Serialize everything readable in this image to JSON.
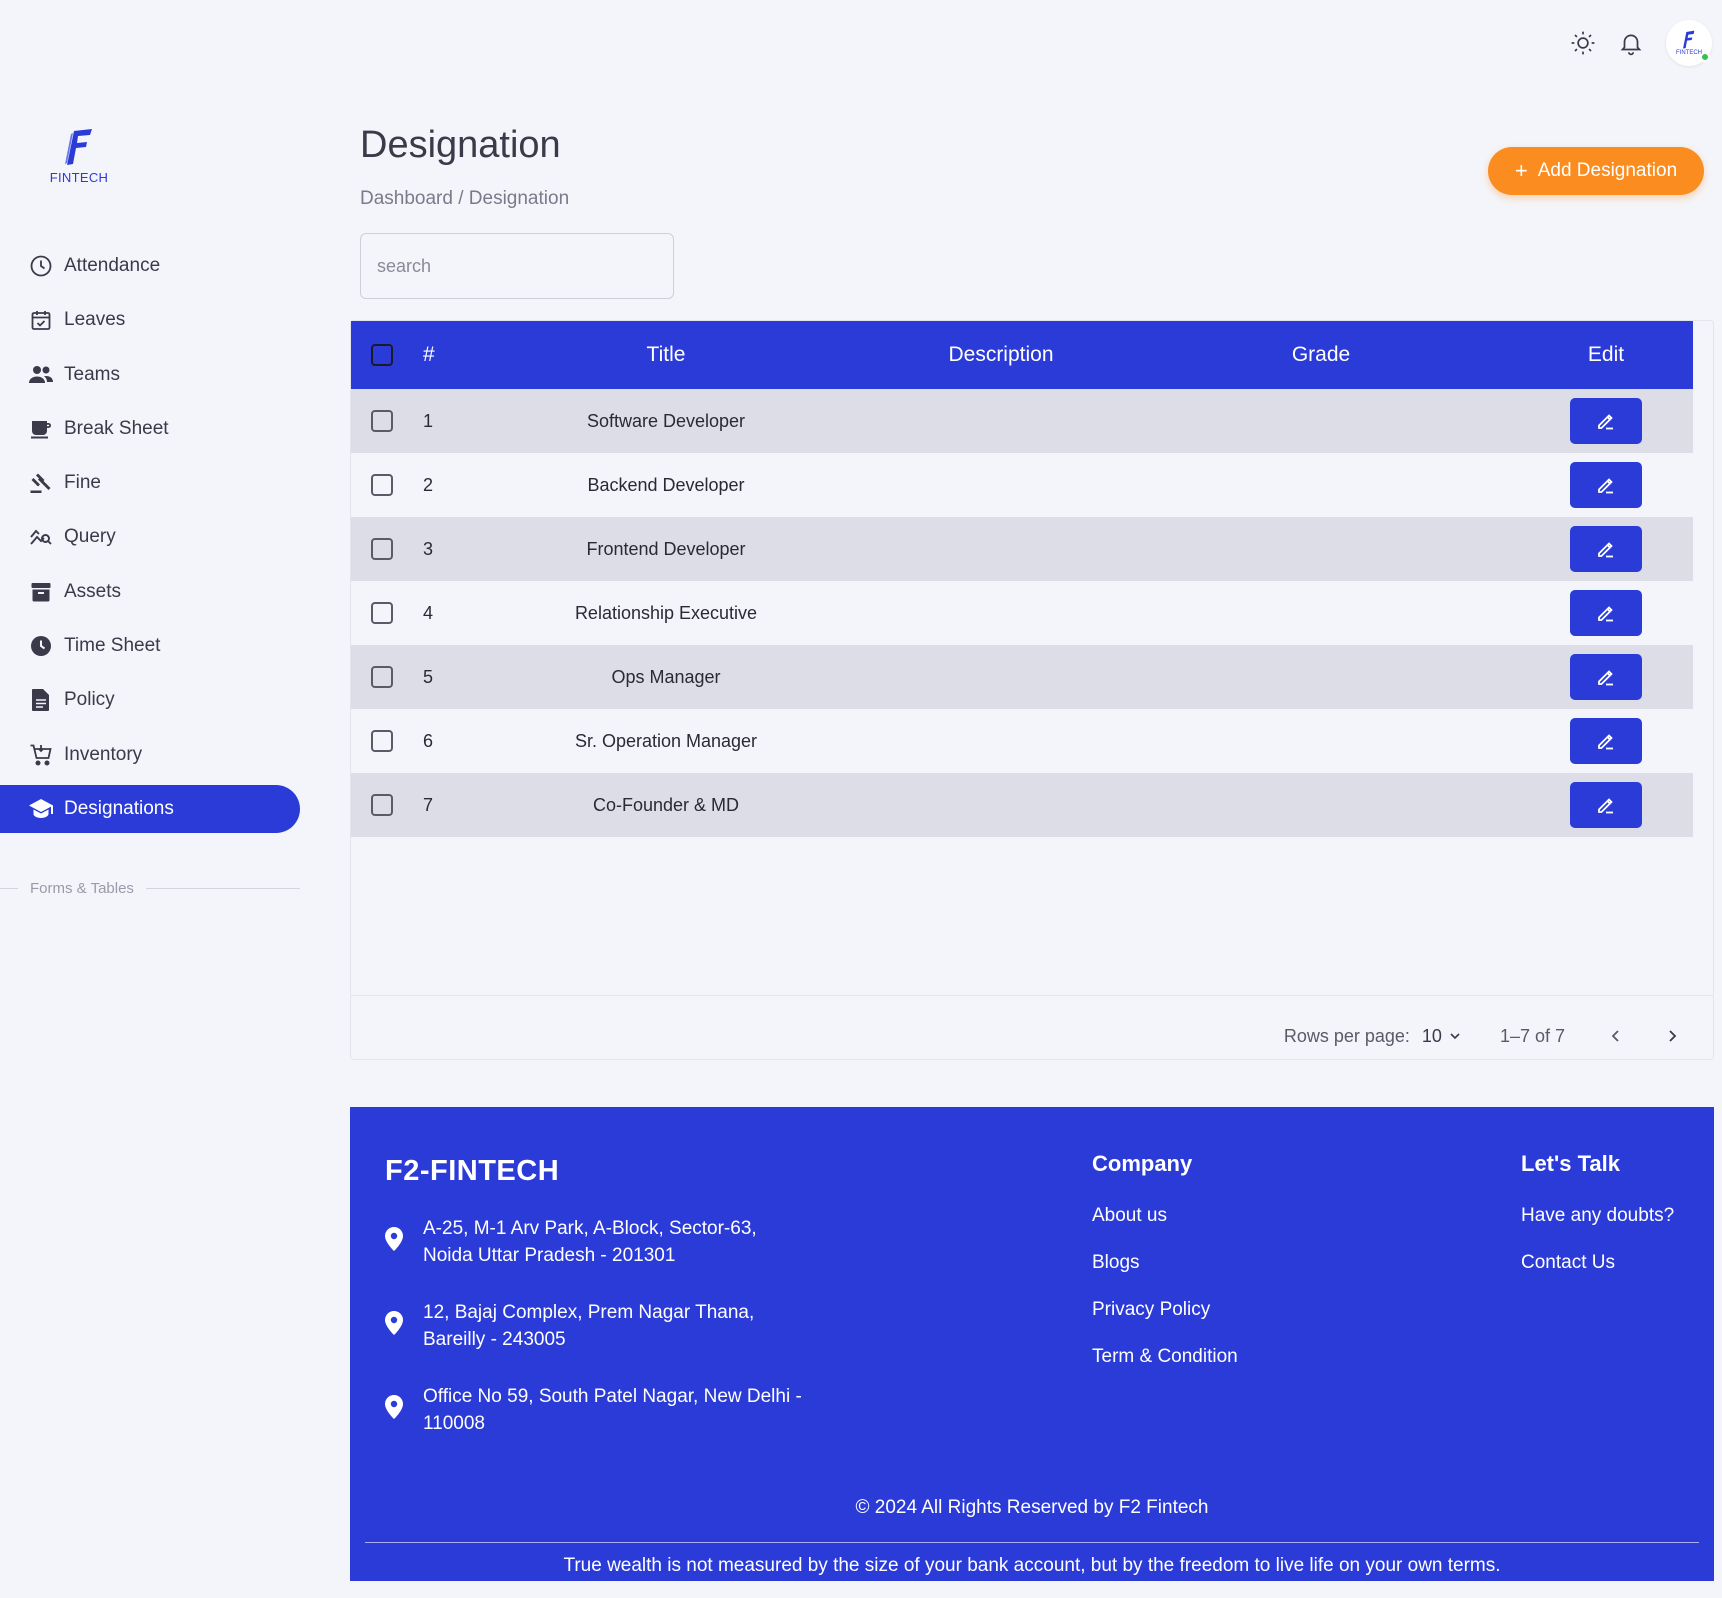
{
  "brand": {
    "logo_text": "FINTECH"
  },
  "topbar": {
    "avatar_text": "FINTECH"
  },
  "sidebar": {
    "items": [
      {
        "label": "Attendance",
        "icon": "clock-icon"
      },
      {
        "label": "Leaves",
        "icon": "calendar-check-icon"
      },
      {
        "label": "Teams",
        "icon": "people-icon"
      },
      {
        "label": "Break Sheet",
        "icon": "coffee-icon"
      },
      {
        "label": "Fine",
        "icon": "gavel-icon"
      },
      {
        "label": "Query",
        "icon": "query-chart-icon"
      },
      {
        "label": "Assets",
        "icon": "archive-icon"
      },
      {
        "label": "Time Sheet",
        "icon": "clock-filled-icon"
      },
      {
        "label": "Policy",
        "icon": "document-icon"
      },
      {
        "label": "Inventory",
        "icon": "cart-icon"
      },
      {
        "label": "Designations",
        "icon": "graduation-cap-icon",
        "active": true
      }
    ],
    "section_label": "Forms & Tables"
  },
  "page": {
    "title": "Designation",
    "breadcrumb": "Dashboard / Designation",
    "add_button": "Add Designation",
    "add_button_icon": "+",
    "search_placeholder": "search"
  },
  "table": {
    "headers": {
      "num": "#",
      "title": "Title",
      "description": "Description",
      "grade": "Grade",
      "edit": "Edit"
    },
    "rows": [
      {
        "num": "1",
        "title": "Software Developer",
        "description": "",
        "grade": ""
      },
      {
        "num": "2",
        "title": "Backend Developer",
        "description": "",
        "grade": ""
      },
      {
        "num": "3",
        "title": "Frontend Developer",
        "description": "",
        "grade": ""
      },
      {
        "num": "4",
        "title": "Relationship Executive",
        "description": "",
        "grade": ""
      },
      {
        "num": "5",
        "title": "Ops Manager",
        "description": "",
        "grade": ""
      },
      {
        "num": "6",
        "title": "Sr. Operation Manager",
        "description": "",
        "grade": ""
      },
      {
        "num": "7",
        "title": "Co-Founder & MD",
        "description": "",
        "grade": ""
      }
    ],
    "pagination": {
      "rows_per_page_label": "Rows per page:",
      "rows_per_page": "10",
      "range": "1–7 of 7"
    }
  },
  "footer": {
    "brand": "F2-FINTECH",
    "addresses": [
      {
        "line1": "A-25, M-1 Arv Park, A-Block, Sector-63,",
        "line2": "Noida Uttar Pradesh - 201301"
      },
      {
        "line1": "12, Bajaj Complex, Prem Nagar Thana,",
        "line2": "Bareilly - 243005"
      },
      {
        "line1": "Office No 59, South Patel Nagar, New Delhi -",
        "line2": "110008"
      }
    ],
    "company_title": "Company",
    "company_links": [
      "About us",
      "Blogs",
      "Privacy Policy",
      "Term & Condition"
    ],
    "talk_title": "Let's Talk",
    "talk_links": [
      "Have any doubts?",
      "Contact Us"
    ],
    "copyright": "© 2024 All Rights Reserved by F2 Fintech",
    "quote": "True wealth is not measured by the size of your bank account, but by the freedom to live life on your own terms."
  },
  "colors": {
    "primary": "#2b3bd8",
    "accent": "#fb8c1f",
    "row_alt": "#dcdde6",
    "background": "#f4f5fa"
  }
}
